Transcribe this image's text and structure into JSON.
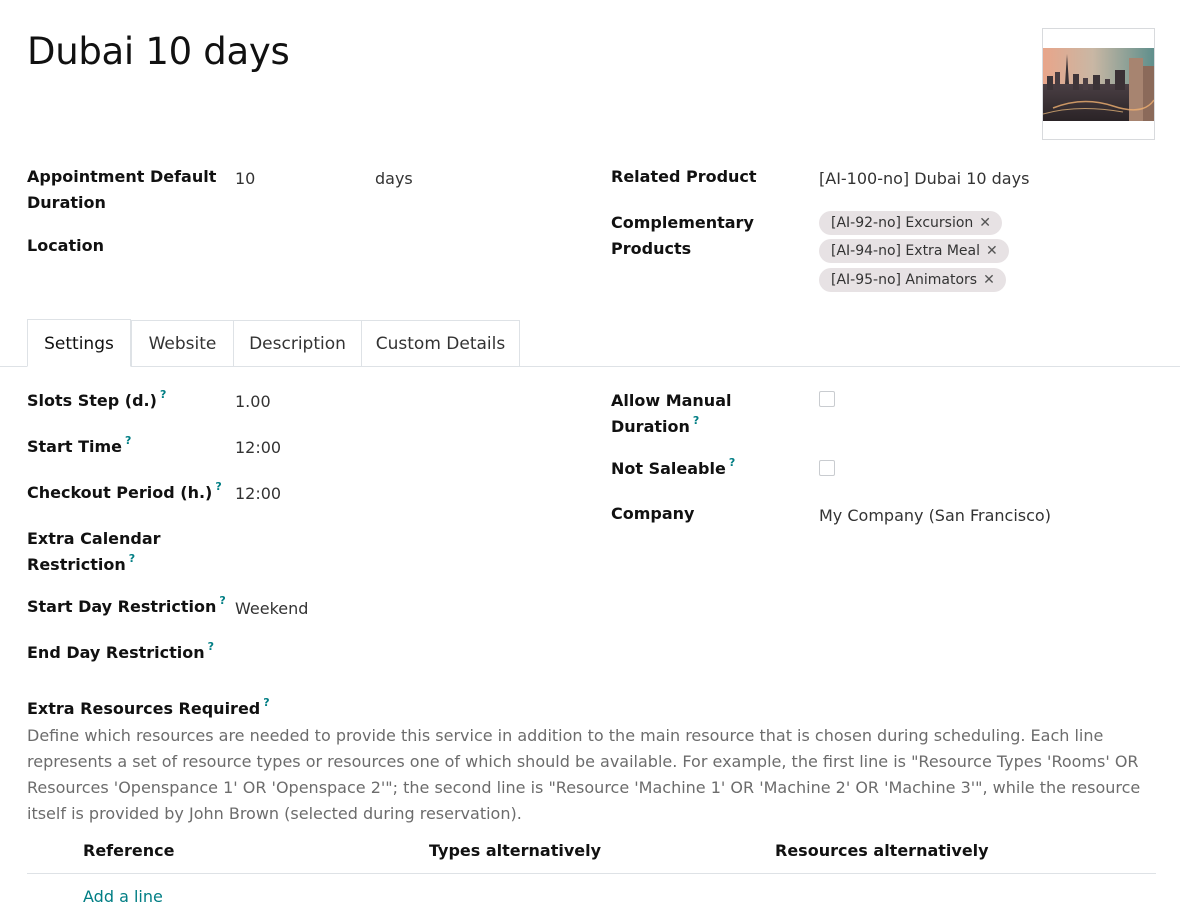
{
  "record": {
    "title": "Dubai 10 days"
  },
  "header_fields": {
    "duration_label_line1": "Appointment Default",
    "duration_label_line2": "Duration",
    "duration_value": "10",
    "duration_unit": "days",
    "location_label": "Location",
    "related_product_label": "Related Product",
    "related_product_value": "[AI-100-no] Dubai 10 days",
    "complementary_label_line1": "Complementary",
    "complementary_label_line2": "Products",
    "complementary_tags": [
      "[AI-92-no] Excursion",
      "[AI-94-no] Extra Meal",
      "[AI-95-no] Animators"
    ]
  },
  "tabs": [
    "Settings",
    "Website",
    "Description",
    "Custom Details"
  ],
  "settings": {
    "help_mark": "?",
    "slots_step_label": "Slots Step (d.)",
    "slots_step_value": "1.00",
    "start_time_label": "Start Time",
    "start_time_value": "12:00",
    "checkout_period_label": "Checkout Period (h.)",
    "checkout_period_value": "12:00",
    "extra_calendar_label_line1": "Extra Calendar",
    "extra_calendar_label_line2": "Restriction",
    "start_day_label": "Start Day Restriction",
    "start_day_value": "Weekend",
    "end_day_label": "End Day Restriction",
    "allow_manual_label_line1": "Allow Manual",
    "allow_manual_label_line2": "Duration",
    "not_saleable_label": "Not Saleable",
    "company_label": "Company",
    "company_value": "My Company (San Francisco)"
  },
  "extra_resources": {
    "label": "Extra Resources Required",
    "description": "Define which resources are needed to provide this service in addition to the main resource that is chosen during scheduling. Each line represents a set of resource types or resources one of which should be available. For example, the first line is \"Resource Types 'Rooms' OR Resources 'Openspance 1' OR 'Openspace 2'\"; the second line is \"Resource 'Machine 1' OR 'Machine 2' OR 'Machine 3'\", while the resource itself is provided by John Brown (selected during reservation).",
    "columns": [
      "Reference",
      "Types alternatively",
      "Resources alternatively"
    ],
    "add_line": "Add a line"
  },
  "colors": {
    "accent": "#017e84",
    "tag_bg": "#e7e2e4",
    "border": "#dee2e6"
  }
}
